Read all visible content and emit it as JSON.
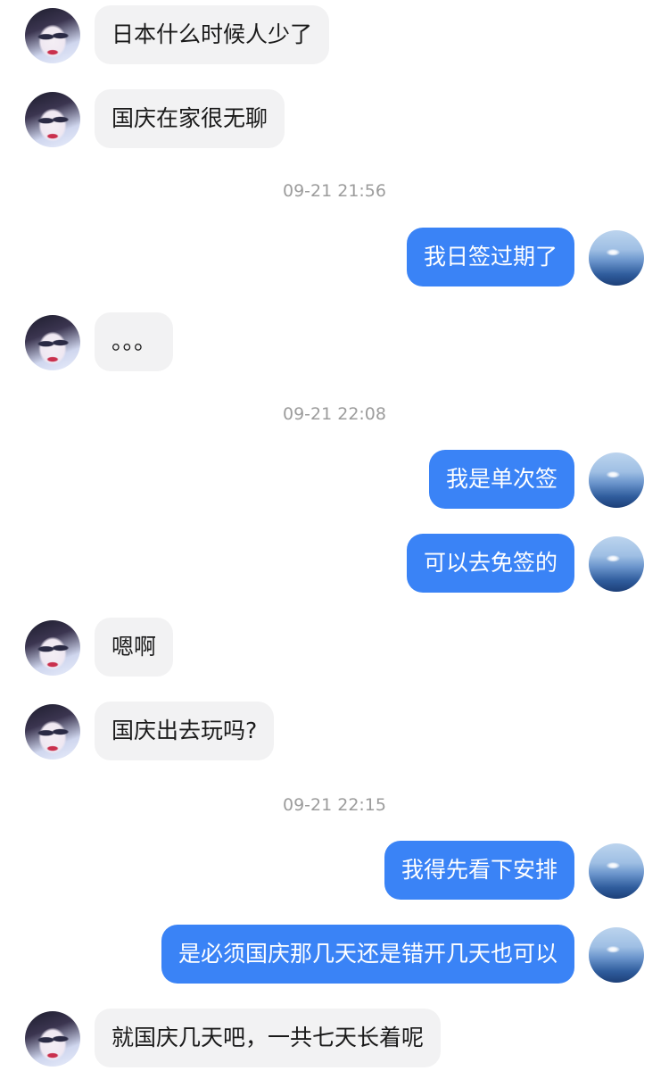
{
  "messages": [
    {
      "type": "msg",
      "side": "in",
      "text": "日本什么时候人少了"
    },
    {
      "type": "msg",
      "side": "in",
      "text": "国庆在家很无聊"
    },
    {
      "type": "time",
      "text": "09-21 21:56"
    },
    {
      "type": "msg",
      "side": "out",
      "text": "我日签过期了"
    },
    {
      "type": "msg",
      "side": "in",
      "text": "。。。"
    },
    {
      "type": "time",
      "text": "09-21 22:08"
    },
    {
      "type": "msg",
      "side": "out",
      "text": "我是单次签"
    },
    {
      "type": "msg",
      "side": "out",
      "text": "可以去免签的"
    },
    {
      "type": "msg",
      "side": "in",
      "text": "嗯啊"
    },
    {
      "type": "msg",
      "side": "in",
      "text": "国庆出去玩吗?"
    },
    {
      "type": "time",
      "text": "09-21 22:15"
    },
    {
      "type": "msg",
      "side": "out",
      "text": "我得先看下安排"
    },
    {
      "type": "msg",
      "side": "out",
      "text": "是必须国庆那几天还是错开几天也可以"
    },
    {
      "type": "msg",
      "side": "in",
      "text": "就国庆几天吧，一共七天长着呢"
    }
  ],
  "colors": {
    "incoming_bubble": "#f2f2f3",
    "outgoing_bubble": "#3a83f6",
    "timestamp_text": "#9c9c9c"
  }
}
